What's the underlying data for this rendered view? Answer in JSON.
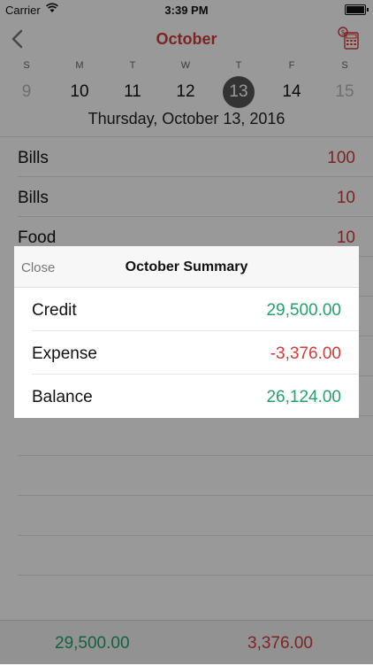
{
  "status": {
    "carrier": "Carrier",
    "time": "3:39 PM"
  },
  "nav": {
    "title": "October"
  },
  "week": {
    "days": [
      {
        "wd": "S",
        "num": "9",
        "state": "dim"
      },
      {
        "wd": "M",
        "num": "10",
        "state": "normal"
      },
      {
        "wd": "T",
        "num": "11",
        "state": "normal"
      },
      {
        "wd": "W",
        "num": "12",
        "state": "normal"
      },
      {
        "wd": "T",
        "num": "13",
        "state": "selected"
      },
      {
        "wd": "F",
        "num": "14",
        "state": "normal"
      },
      {
        "wd": "S",
        "num": "15",
        "state": "dim"
      }
    ],
    "full_date": "Thursday, October 13, 2016"
  },
  "entries": [
    {
      "label": "Bills",
      "amount": "100"
    },
    {
      "label": "Bills",
      "amount": "10"
    },
    {
      "label": "Food",
      "amount": "10"
    },
    {
      "label": "",
      "amount": ""
    },
    {
      "label": "",
      "amount": ""
    },
    {
      "label": "",
      "amount": ""
    },
    {
      "label": "",
      "amount": ""
    },
    {
      "label": "",
      "amount": ""
    },
    {
      "label": "",
      "amount": ""
    },
    {
      "label": "",
      "amount": ""
    },
    {
      "label": "",
      "amount": ""
    }
  ],
  "footer": {
    "credit_total": "29,500.00",
    "expense_total": "3,376.00"
  },
  "summary": {
    "close_label": "Close",
    "title": "October Summary",
    "rows": [
      {
        "label": "Credit",
        "value": "29,500.00",
        "tone": "green"
      },
      {
        "label": "Expense",
        "value": "-3,376.00",
        "tone": "red"
      },
      {
        "label": "Balance",
        "value": "26,124.00",
        "tone": "green"
      }
    ]
  },
  "colors": {
    "accent": "#d33b3b",
    "credit": "#24a26a",
    "selected_day": "#555555"
  }
}
